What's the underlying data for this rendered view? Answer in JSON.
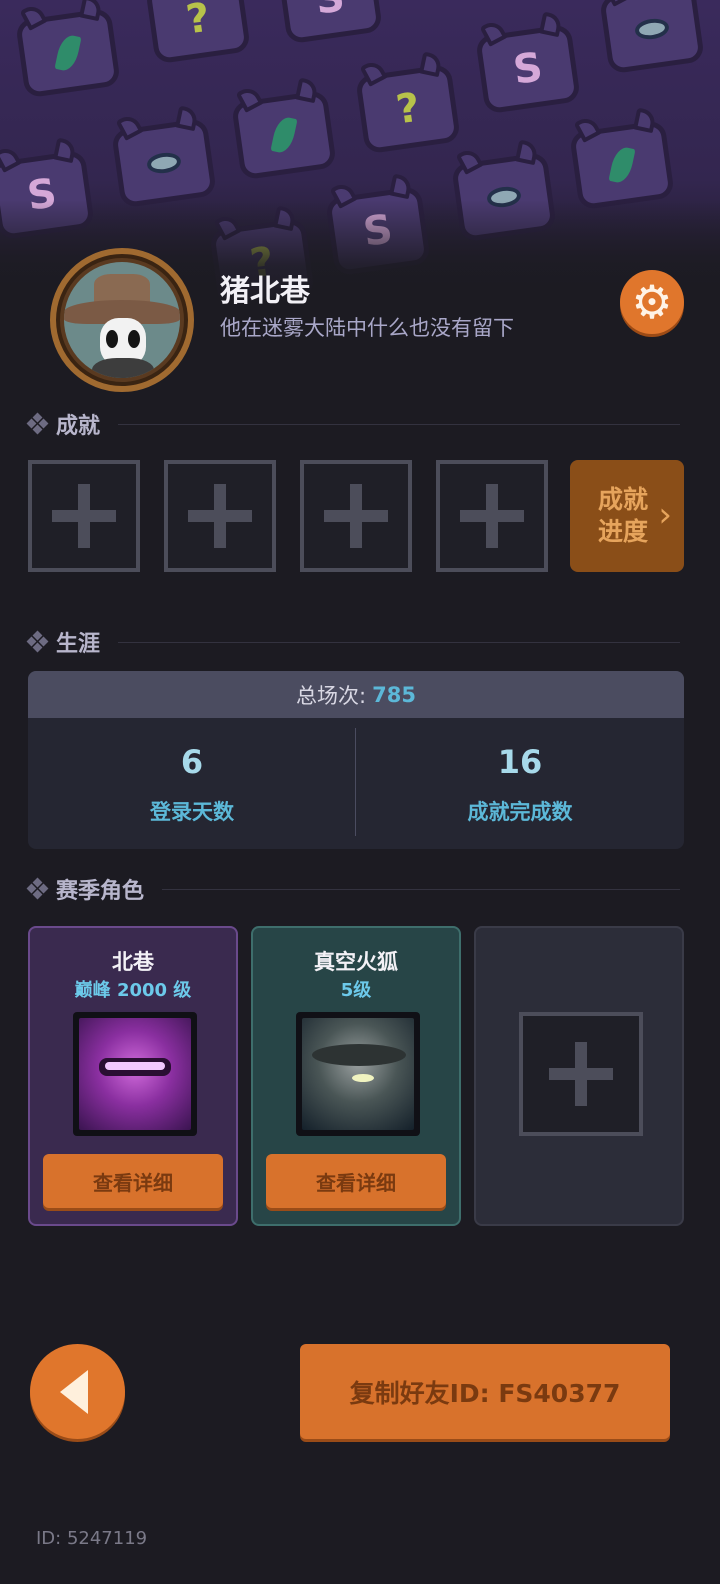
{
  "profile": {
    "name": "猪北巷",
    "signature": "他在迷雾大陆中什么也没有留下"
  },
  "icons": {
    "settings": "gear-icon",
    "back": "back-arrow-icon",
    "add": "plus-icon"
  },
  "colors": {
    "accent": "#e0762c",
    "highlight": "#5cb8d8",
    "background": "#1c1b22"
  },
  "achievements": {
    "title": "成就",
    "progress_label_line1": "成就",
    "progress_label_line2": "进度"
  },
  "career": {
    "title": "生涯",
    "total_label": "总场次:",
    "total_value": "785",
    "stats": [
      {
        "value": "6",
        "label": "登录天数"
      },
      {
        "value": "16",
        "label": "成就完成数"
      }
    ]
  },
  "season": {
    "title": "赛季角色",
    "characters": [
      {
        "name": "北巷",
        "level": "巅峰 2000 级",
        "button": "查看详细"
      },
      {
        "name": "真空火狐",
        "level": "5级",
        "button": "查看详细"
      }
    ]
  },
  "footer": {
    "copy_button": "复制好友ID: FS40377",
    "player_id": "ID: 5247119"
  }
}
